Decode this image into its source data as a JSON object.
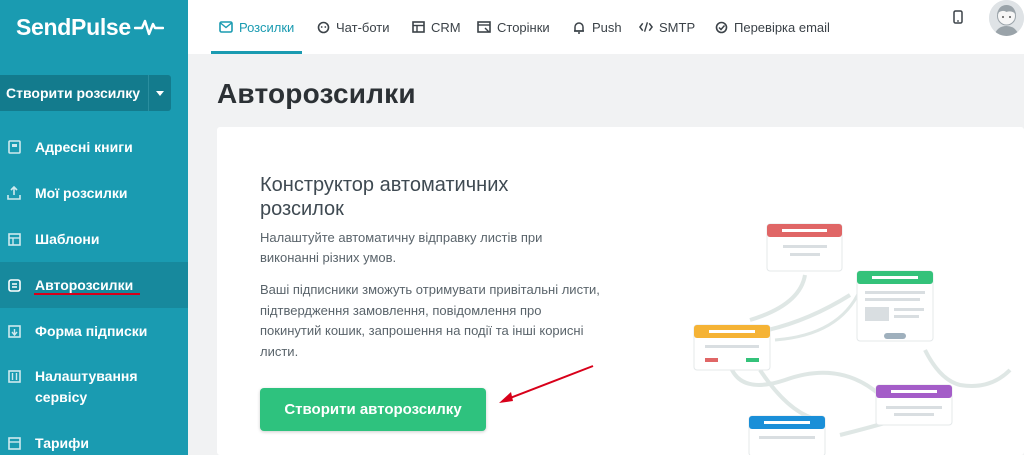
{
  "app": {
    "logo_text": "SendPulse"
  },
  "sidebar": {
    "create_button_label": "Створити розсилку",
    "items": [
      {
        "label": "Адресні книги",
        "icon": "address-book-icon"
      },
      {
        "label": "Мої розсилки",
        "icon": "upload-icon"
      },
      {
        "label": "Шаблони",
        "icon": "template-icon"
      },
      {
        "label": "Авторозсилки",
        "icon": "automation-icon",
        "active": true
      },
      {
        "label": "Форма підписки",
        "icon": "subscription-form-icon"
      },
      {
        "label": "Налаштування сервісу",
        "icon": "settings-icon"
      },
      {
        "label": "Тарифи",
        "icon": "pricing-icon"
      }
    ]
  },
  "topnav": {
    "tabs": [
      {
        "label": "Розсилки",
        "icon": "mail-icon",
        "active": true
      },
      {
        "label": "Чат-боти",
        "icon": "chatbot-icon"
      },
      {
        "label": "CRM",
        "icon": "crm-icon"
      },
      {
        "label": "Сторінки",
        "icon": "pages-icon"
      },
      {
        "label": "Push",
        "icon": "bell-icon"
      },
      {
        "label": "SMTP",
        "icon": "code-icon"
      },
      {
        "label": "Перевірка email",
        "icon": "check-circle-icon"
      }
    ]
  },
  "main": {
    "page_title": "Авторозсилки",
    "card": {
      "title": "Конструктор автоматичних розсилок",
      "paragraph1": "Налаштуйте автоматичну відправку листів при виконанні різних умов.",
      "paragraph2": "Ваші підписники зможуть отримувати привітальні листи, підтвердження замовлення, повідомлення про покинутий кошик, запрошення на події та інші корисні листи.",
      "button_label": "Створити авторозсилку"
    }
  },
  "colors": {
    "sidebar_bg": "#1a9bb1",
    "accent": "#1a9bb1",
    "primary_button": "#2ec27e",
    "annotation_red": "#d8001a"
  }
}
